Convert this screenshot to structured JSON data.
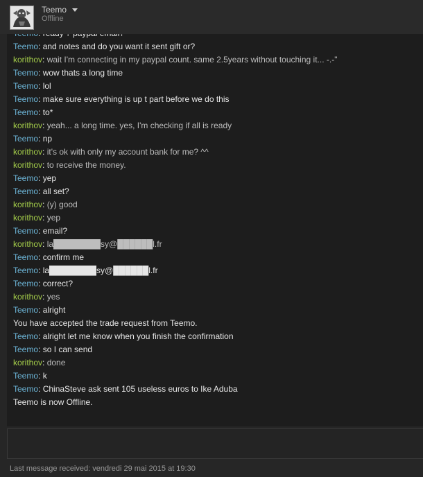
{
  "header": {
    "username": "Teemo",
    "status": "Offline",
    "avatar_icon": "gargoyle-avatar-icon",
    "dropdown_icon": "caret-down-icon"
  },
  "colors": {
    "teemo": "#6cb4d6",
    "korithov": "#a4cd4a",
    "message": "#e6e6e6",
    "background": "#1d1d1d"
  },
  "messages": [
    {
      "type": "chat",
      "sender": "Teemo",
      "sender_class": "teemo",
      "text": "ready ? paypal email?"
    },
    {
      "type": "chat",
      "sender": "Teemo",
      "sender_class": "teemo",
      "text": "and notes and do you want it sent gift or?"
    },
    {
      "type": "chat",
      "sender": "korithov",
      "sender_class": "korithov",
      "text": "wait I'm connecting in my paypal count. same 2.5years without touching it... -.-\""
    },
    {
      "type": "chat",
      "sender": "Teemo",
      "sender_class": "teemo",
      "text": "wow thats a long time"
    },
    {
      "type": "chat",
      "sender": "Teemo",
      "sender_class": "teemo",
      "text": "lol"
    },
    {
      "type": "chat",
      "sender": "Teemo",
      "sender_class": "teemo",
      "text": "make sure everything is up t part before we do this"
    },
    {
      "type": "chat",
      "sender": "Teemo",
      "sender_class": "teemo",
      "text": "to*"
    },
    {
      "type": "chat",
      "sender": "korithov",
      "sender_class": "korithov",
      "text": "yeah... a long time. yes, I'm checking if all is ready"
    },
    {
      "type": "chat",
      "sender": "Teemo",
      "sender_class": "teemo",
      "text": "np"
    },
    {
      "type": "chat",
      "sender": "korithov",
      "sender_class": "korithov",
      "text": "it's ok with only my account bank for me? ^^"
    },
    {
      "type": "chat",
      "sender": "korithov",
      "sender_class": "korithov",
      "text": "to receive the money."
    },
    {
      "type": "chat",
      "sender": "Teemo",
      "sender_class": "teemo",
      "text": "yep"
    },
    {
      "type": "chat",
      "sender": "Teemo",
      "sender_class": "teemo",
      "text": "all set?"
    },
    {
      "type": "chat",
      "sender": "korithov",
      "sender_class": "korithov",
      "text": "(y) good"
    },
    {
      "type": "chat",
      "sender": "korithov",
      "sender_class": "korithov",
      "text": "yep"
    },
    {
      "type": "chat",
      "sender": "Teemo",
      "sender_class": "teemo",
      "text": "email?"
    },
    {
      "type": "chat",
      "sender": "korithov",
      "sender_class": "korithov",
      "text": "la████████sy@██████l.fr"
    },
    {
      "type": "chat",
      "sender": "Teemo",
      "sender_class": "teemo",
      "text": "confirm me"
    },
    {
      "type": "chat",
      "sender": "Teemo",
      "sender_class": "teemo",
      "text": "la████████sy@██████l.fr"
    },
    {
      "type": "chat",
      "sender": "Teemo",
      "sender_class": "teemo",
      "text": "correct?"
    },
    {
      "type": "chat",
      "sender": "korithov",
      "sender_class": "korithov",
      "text": "yes"
    },
    {
      "type": "chat",
      "sender": "Teemo",
      "sender_class": "teemo",
      "text": "alright"
    },
    {
      "type": "system",
      "text": "You have accepted the trade request from Teemo."
    },
    {
      "type": "chat",
      "sender": "Teemo",
      "sender_class": "teemo",
      "text": "alright let me know when you finish the confirmation"
    },
    {
      "type": "chat",
      "sender": "Teemo",
      "sender_class": "teemo",
      "text": "so I can send"
    },
    {
      "type": "chat",
      "sender": "korithov",
      "sender_class": "korithov",
      "text": "done"
    },
    {
      "type": "chat",
      "sender": "Teemo",
      "sender_class": "teemo",
      "text": "k"
    },
    {
      "type": "chat",
      "sender": "Teemo",
      "sender_class": "teemo",
      "text": "ChinaSteve ask sent 105 useless euros to Ike Aduba"
    },
    {
      "type": "system",
      "text": "Teemo is now Offline."
    }
  ],
  "input": {
    "value": "",
    "placeholder": ""
  },
  "footer": {
    "text": "Last message received: vendredi 29 mai 2015 at 19:30"
  }
}
